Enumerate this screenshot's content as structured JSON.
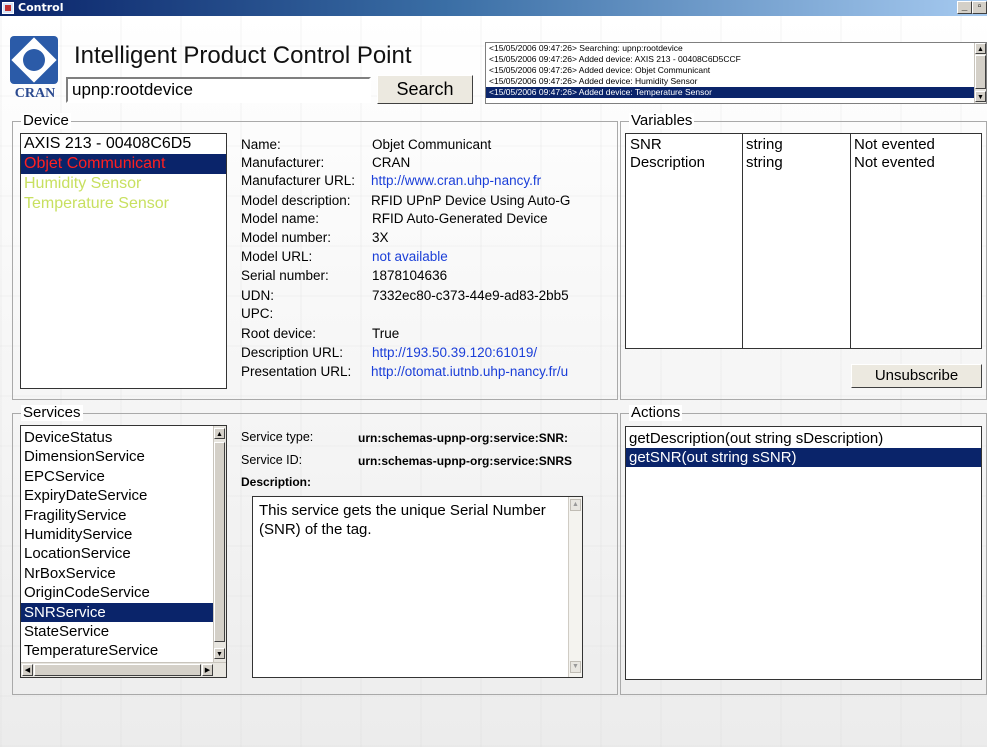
{
  "window": {
    "title": "Control"
  },
  "header": {
    "logo_text": "CRAN",
    "app_title": "Intelligent Product Control Point",
    "search": {
      "value": "upnp:rootdevice"
    },
    "search_button": "Search"
  },
  "log": {
    "lines": [
      "<15/05/2006 09:47:26> Searching: upnp:rootdevice",
      "<15/05/2006 09:47:26> Added device: AXIS 213 - 00408C6D5CCF",
      "<15/05/2006 09:47:26> Added device: Objet Communicant",
      "<15/05/2006 09:47:26> Added device: Humidity Sensor",
      "<15/05/2006 09:47:26> Added device: Temperature Sensor"
    ]
  },
  "device": {
    "group_title": "Device",
    "items": [
      {
        "label": "AXIS 213 - 00408C6D5",
        "color": "#000000"
      },
      {
        "label": "Objet Communicant",
        "color": "#ff2020"
      },
      {
        "label": "Humidity Sensor",
        "color": "#c8e060"
      },
      {
        "label": "Temperature Sensor",
        "color": "#c8e060"
      }
    ],
    "properties": [
      {
        "label": "Name:",
        "value": "Objet Communicant"
      },
      {
        "label": "Manufacturer:",
        "value": "CRAN"
      },
      {
        "label": "Manufacturer URL:",
        "value": "http://www.cran.uhp-nancy.fr"
      },
      {
        "label": "Model description:",
        "value": "RFID UPnP Device Using Auto-G"
      },
      {
        "label": "Model name:",
        "value": "RFID Auto-Generated Device"
      },
      {
        "label": "Model number:",
        "value": "3X"
      },
      {
        "label": "Model URL:",
        "value": "not available"
      },
      {
        "label": "Serial number:",
        "value": "1878104636"
      },
      {
        "label": "UDN:",
        "value": "7332ec80-c373-44e9-ad83-2bb5"
      },
      {
        "label": "UPC:",
        "value": ""
      },
      {
        "label": "Root device:",
        "value": "True"
      },
      {
        "label": "Description URL:",
        "value": "http://193.50.39.120:61019/"
      },
      {
        "label": "Presentation URL:",
        "value": "http://otomat.iutnb.uhp-nancy.fr/u"
      }
    ]
  },
  "variables": {
    "group_title": "Variables",
    "rows": [
      {
        "name": "SNR",
        "type": "string",
        "evented": "Not evented"
      },
      {
        "name": "Description",
        "type": "string",
        "evented": "Not evented"
      }
    ],
    "unsubscribe_button": "Unsubscribe"
  },
  "services": {
    "group_title": "Services",
    "items": [
      "DeviceStatus",
      "DimensionService",
      "EPCService",
      "ExpiryDateService",
      "FragilityService",
      "HumidityService",
      "LocationService",
      "NrBoxService",
      "OriginCodeService",
      "SNRService",
      "StateService",
      "TemperatureService"
    ],
    "selected_index": 9,
    "service_type_label": "Service type:",
    "service_type_value": "urn:schemas-upnp-org:service:SNR:",
    "service_id_label": "Service ID:",
    "service_id_value": "urn:schemas-upnp-org:service:SNRS",
    "description_label": "Description:",
    "description_text": "This service gets the unique Serial Number (SNR) of the tag."
  },
  "actions": {
    "group_title": "Actions",
    "items": [
      "getDescription(out string sDescription)",
      "getSNR(out string sSNR)"
    ],
    "selected_index": 1
  }
}
